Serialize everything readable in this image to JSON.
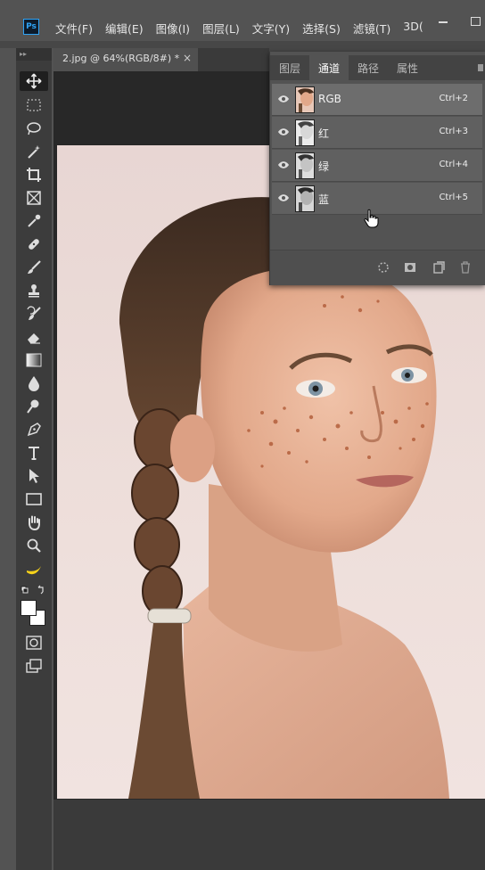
{
  "app": {
    "logo": "Ps"
  },
  "menu": {
    "items": [
      "文件(F)",
      "编辑(E)",
      "图像(I)",
      "图层(L)",
      "文字(Y)",
      "选择(S)",
      "滤镜(T)",
      "3D("
    ]
  },
  "document": {
    "tab_title": "2.jpg @ 64%(RGB/8#) *",
    "close_glyph": "×"
  },
  "panel": {
    "tabs": [
      "图层",
      "通道",
      "路径",
      "属性"
    ],
    "active_tab": "通道",
    "channels": [
      {
        "name": "RGB",
        "shortcut": "Ctrl+2",
        "visible": true
      },
      {
        "name": "红",
        "shortcut": "Ctrl+3",
        "visible": true
      },
      {
        "name": "绿",
        "shortcut": "Ctrl+4",
        "visible": true
      },
      {
        "name": "蓝",
        "shortcut": "Ctrl+5",
        "visible": true
      }
    ],
    "bottom_icons": [
      "load-selection-icon",
      "save-selection-icon",
      "new-channel-icon",
      "delete-channel-icon"
    ]
  },
  "toolbar": {
    "tools": [
      {
        "name": "move-tool",
        "glyph": "✥",
        "active": true
      },
      {
        "name": "marquee-tool",
        "glyph": "⬚"
      },
      {
        "name": "lasso-tool",
        "glyph": "◌"
      },
      {
        "name": "magic-wand-tool",
        "glyph": "✧"
      },
      {
        "name": "crop-tool",
        "glyph": "⌗"
      },
      {
        "name": "frame-tool",
        "glyph": "⊠"
      },
      {
        "name": "eyedropper-tool",
        "glyph": "⟋"
      },
      {
        "name": "healing-brush-tool",
        "glyph": "✚"
      },
      {
        "name": "brush-tool",
        "glyph": "⟋"
      },
      {
        "name": "clone-stamp-tool",
        "glyph": "⊥"
      },
      {
        "name": "history-brush-tool",
        "glyph": "↺"
      },
      {
        "name": "eraser-tool",
        "glyph": "▱"
      },
      {
        "name": "gradient-tool",
        "glyph": "▣"
      },
      {
        "name": "blur-tool",
        "glyph": "●"
      },
      {
        "name": "dodge-tool",
        "glyph": "⚲"
      },
      {
        "name": "pen-tool",
        "glyph": "✒"
      },
      {
        "name": "type-tool",
        "glyph": "T"
      },
      {
        "name": "path-selection-tool",
        "glyph": "➤"
      },
      {
        "name": "rectangle-tool",
        "glyph": "▭"
      },
      {
        "name": "hand-tool",
        "glyph": "✋"
      },
      {
        "name": "zoom-tool",
        "glyph": "⚲"
      },
      {
        "name": "banana-tool",
        "glyph": "☽"
      }
    ],
    "colors": {
      "foreground": "#ffffff",
      "background": "#ffffff"
    }
  },
  "colors": {
    "accent": "#2fa3f5",
    "panel_bg": "#535353",
    "canvas_bg": "#282828"
  }
}
